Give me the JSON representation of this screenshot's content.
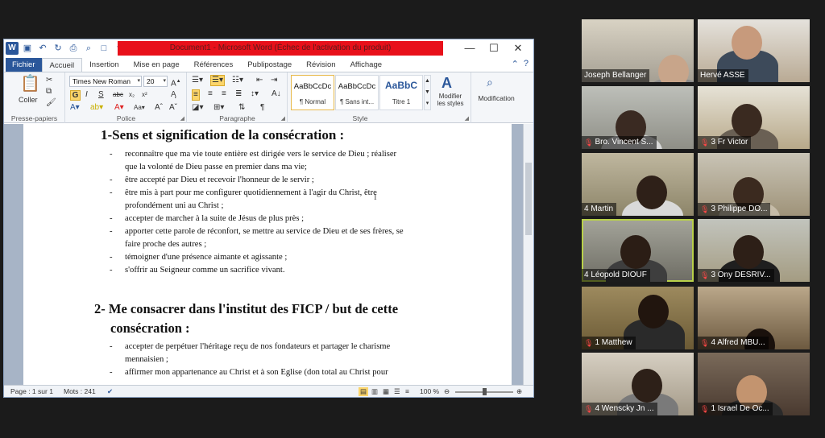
{
  "word": {
    "title": "Document1 - Microsoft Word (Échec de l'activation du produit)",
    "tabs": [
      "Fichier",
      "Accueil",
      "Insertion",
      "Mise en page",
      "Références",
      "Publipostage",
      "Révision",
      "Affichage"
    ],
    "active_tab": "Accueil",
    "ribbon": {
      "paste_label": "Coller",
      "group_clipboard": "Presse-papiers",
      "font_name": "Times New Roman",
      "font_size": "20",
      "group_font": "Police",
      "group_paragraph": "Paragraphe",
      "group_style": "Style",
      "styles": [
        {
          "preview": "AaBbCcDc",
          "name": "¶ Normal"
        },
        {
          "preview": "AaBbCcDc",
          "name": "¶ Sans int..."
        },
        {
          "preview": "AaBbC",
          "name": "Titre 1"
        }
      ],
      "modify_styles": "Modifier les styles",
      "modification": "Modification"
    },
    "document": {
      "heading1": "1-Sens et signification de la consécration :",
      "list1": [
        [
          "reconnaître que ma vie toute entière est dirigée vers le service de Dieu ; réaliser",
          "que la volonté de Dieu passe en premier dans ma vie;"
        ],
        [
          "être accepté par Dieu et recevoir l'honneur de le servir ;"
        ],
        [
          "être mis à part pour me configurer quotidiennement à l'agir du Christ, être",
          "profondément uni au Christ ;"
        ],
        [
          "accepter de marcher à la suite de Jésus de plus près ;"
        ],
        [
          "apporter cette parole de réconfort, se mettre au service de Dieu et de ses frères, se",
          "faire proche des autres ;"
        ],
        [
          "témoigner d'une présence aimante et agissante ;"
        ],
        [
          "s'offrir au Seigneur comme un sacrifice vivant."
        ]
      ],
      "heading2_line1": "2- Me consacrer dans l'institut des FICP /  but de cette",
      "heading2_line2": "consécration :",
      "list2": [
        [
          "accepter de perpétuer l'héritage reçu de nos fondateurs et partager le charisme",
          "mennaisien ;"
        ],
        [
          "affirmer mon appartenance au Christ et à son Eglise (don total au Christ pour"
        ]
      ]
    },
    "status": {
      "page": "Page : 1 sur 1",
      "words": "Mots : 241",
      "zoom": "100 %"
    }
  },
  "participants": [
    {
      "name": "Joseph Bellanger",
      "muted": false
    },
    {
      "name": "Hervé ASSE",
      "muted": false
    },
    {
      "name": "Bro. Vincent S...",
      "muted": true
    },
    {
      "name": "3 Fr Victor",
      "muted": true
    },
    {
      "name": "4 Martin",
      "muted": false
    },
    {
      "name": "3 Philippe DO...",
      "muted": true
    },
    {
      "name": "4 Léopold DIOUF",
      "muted": false
    },
    {
      "name": "3 Ony DESRIV...",
      "muted": true
    },
    {
      "name": "1 Matthew",
      "muted": true
    },
    {
      "name": "4 Alfred MBU...",
      "muted": true
    },
    {
      "name": "4 Wenscky Jn ...",
      "muted": true
    },
    {
      "name": "1 Israel De Oc...",
      "muted": true
    }
  ],
  "active_speaker": "4 Léopold DIOUF",
  "colors": {
    "word_blue": "#2b579a",
    "title_red": "#e8101a",
    "speaker_outline": "#b9d14a",
    "background": "#1b1b1b"
  }
}
